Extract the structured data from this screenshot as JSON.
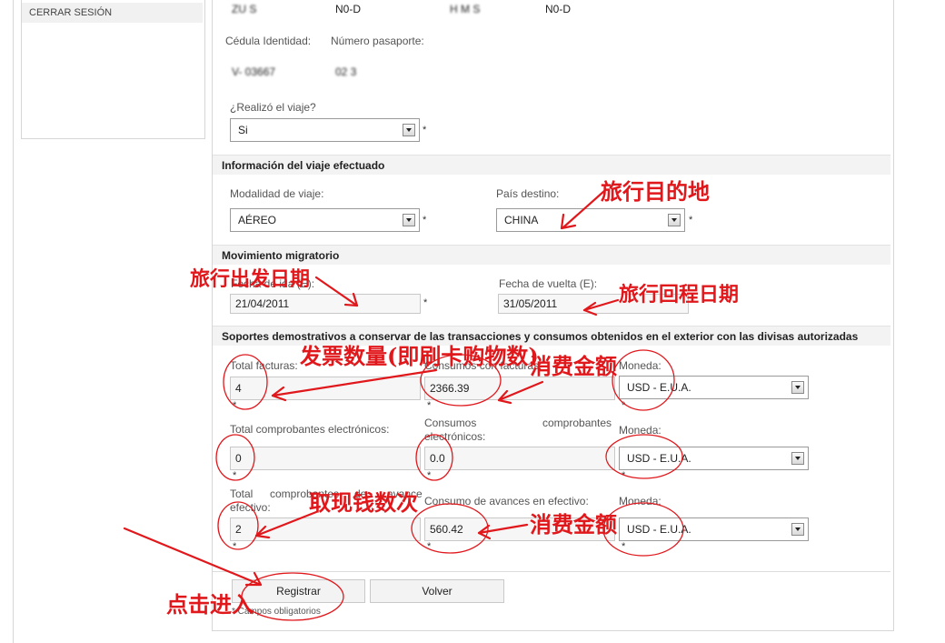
{
  "sidebar": {
    "logout_label": "CERRAR SESIÓN"
  },
  "header_row": {
    "surname_1": "ZU  S",
    "surname_1_code": "N0-D",
    "name_1": "H M S",
    "name_1_code": "N0-D"
  },
  "identity": {
    "cedula_label": "Cédula Identidad:",
    "pasaporte_label": "Número pasaporte:",
    "cedula_value": "V-  03667",
    "pasaporte_value": "02  3   "
  },
  "trip_done": {
    "label": "¿Realizó el viaje?",
    "value": "Si"
  },
  "section_trip": {
    "title": "Información del viaje efectuado",
    "modalidad_label": "Modalidad de viaje:",
    "modalidad_value": "AÉREO",
    "pais_label": "País destino:",
    "pais_value": "CHINA"
  },
  "section_migration": {
    "title": "Movimiento migratorio",
    "ida_label": "Fecha de ida (E):",
    "ida_value": "21/04/2011",
    "vuelta_label": "Fecha de vuelta (E):",
    "vuelta_value": "31/05/2011"
  },
  "section_supports": {
    "title": "Soportes demostrativos a conservar de las transacciones y consumos obtenidos en el exterior con las divisas autorizadas",
    "total_facturas_label": "Total facturas:",
    "total_facturas_value": "4",
    "consumos_facturas_label": "Consumos con facturas:",
    "consumos_facturas_value": "2366.39",
    "moneda_label": "Moneda:",
    "moneda_value": "USD - E.U.A.",
    "total_comprobantes_label": "Total comprobantes electrónicos:",
    "total_comprobantes_value": "0",
    "consumos_comprobantes_label_a": "Consumos",
    "consumos_comprobantes_label_b": "comprobantes",
    "consumos_comprobantes_label_c": "electrónicos:",
    "consumos_comprobantes_value": "0.0",
    "total_avance_label_a": "Total",
    "total_avance_label_b": "comprobantes",
    "total_avance_label_c": "de",
    "total_avance_label_d": "avance",
    "total_avance_label_e": "efectivo:",
    "total_avance_value": "2",
    "consumo_avances_label": "Consumo de avances en efectivo:",
    "consumo_avances_value": "560.42"
  },
  "actions": {
    "registrar_label": "Registrar",
    "volver_label": "Volver",
    "required_note": "* Campos obligatorios"
  },
  "required_mark": "*",
  "annotations": {
    "destination": "旅行目的地",
    "departure": "旅行出发日期",
    "return": "旅行回程日期",
    "invoices": "发票数量(即刷卡购物数)",
    "spend_1": "消费金额",
    "cash_withdrawals": "取现钱数次",
    "spend_2": "消费金额",
    "click_enter": "点击进入",
    "annotation_color": "#e0181c"
  }
}
